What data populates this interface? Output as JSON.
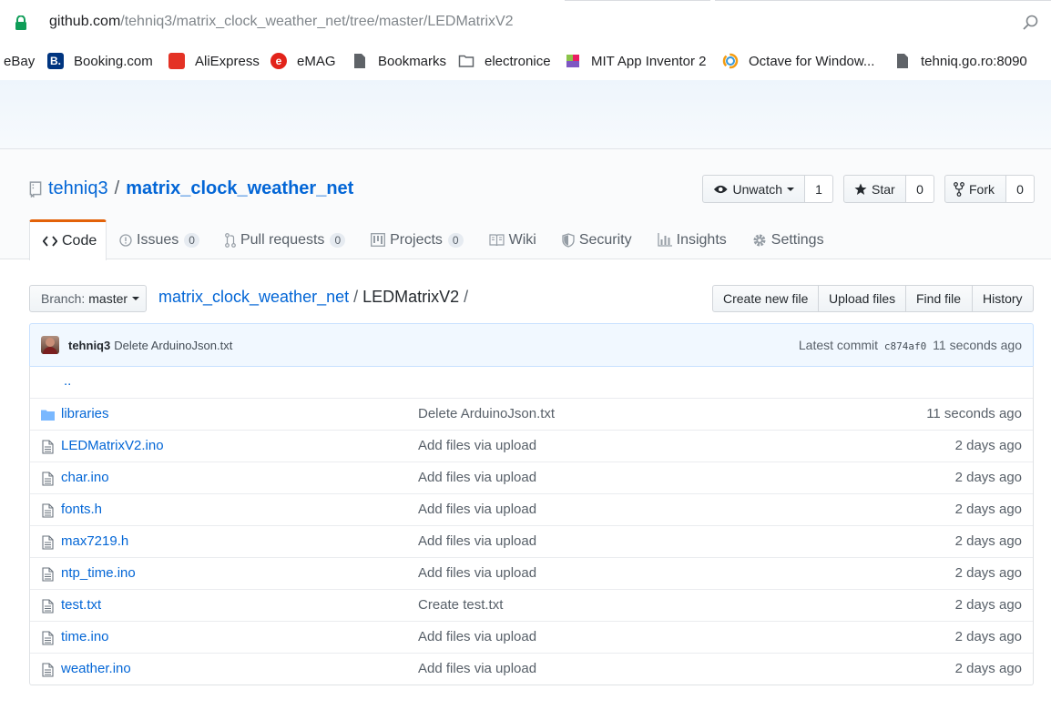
{
  "browser": {
    "url_domain": "github.com",
    "url_path": "/tehniq3/matrix_clock_weather_net/tree/master/LEDMatrixV2"
  },
  "bookmarks": [
    {
      "label": "eBay",
      "icon": "none"
    },
    {
      "label": "Booking.com",
      "icon": "booking-icon"
    },
    {
      "label": "AliExpress",
      "icon": "aliexpress-icon"
    },
    {
      "label": "eMAG",
      "icon": "emag-icon"
    },
    {
      "label": "Bookmarks",
      "icon": "page-icon"
    },
    {
      "label": "electronice",
      "icon": "folder-icon"
    },
    {
      "label": "MIT App Inventor 2",
      "icon": "appinventor-icon"
    },
    {
      "label": "Octave for Window...",
      "icon": "octave-icon"
    },
    {
      "label": "tehniq.go.ro:8090",
      "icon": "page-icon"
    }
  ],
  "repo": {
    "owner": "tehniq3",
    "name": "matrix_clock_weather_net",
    "separator": "/"
  },
  "actions": {
    "watch_label": "Unwatch",
    "watch_count": "1",
    "star_label": "Star",
    "star_count": "0",
    "fork_label": "Fork",
    "fork_count": "0"
  },
  "tabs": [
    {
      "label": "Code",
      "icon": "code-icon",
      "counter": ""
    },
    {
      "label": "Issues",
      "icon": "issue-icon",
      "counter": "0"
    },
    {
      "label": "Pull requests",
      "icon": "pull-request-icon",
      "counter": "0"
    },
    {
      "label": "Projects",
      "icon": "project-icon",
      "counter": "0"
    },
    {
      "label": "Wiki",
      "icon": "book-icon",
      "counter": ""
    },
    {
      "label": "Security",
      "icon": "shield-icon",
      "counter": ""
    },
    {
      "label": "Insights",
      "icon": "graph-icon",
      "counter": ""
    },
    {
      "label": "Settings",
      "icon": "gear-icon",
      "counter": ""
    }
  ],
  "branch": {
    "label": "Branch:",
    "value": "master"
  },
  "breadcrumb": {
    "root": "matrix_clock_weather_net",
    "current": "LEDMatrixV2",
    "sep": "/"
  },
  "file_actions": [
    "Create new file",
    "Upload files",
    "Find file",
    "History"
  ],
  "commit": {
    "author": "tehniq3",
    "message": "Delete ArduinoJson.txt",
    "latest_label": "Latest commit",
    "sha": "c874af0",
    "age": "11 seconds ago"
  },
  "files": {
    "up": "..",
    "rows": [
      {
        "name": "libraries",
        "type": "dir",
        "message": "Delete ArduinoJson.txt",
        "age": "11 seconds ago"
      },
      {
        "name": "LEDMatrixV2.ino",
        "type": "file",
        "message": "Add files via upload",
        "age": "2 days ago"
      },
      {
        "name": "char.ino",
        "type": "file",
        "message": "Add files via upload",
        "age": "2 days ago"
      },
      {
        "name": "fonts.h",
        "type": "file",
        "message": "Add files via upload",
        "age": "2 days ago"
      },
      {
        "name": "max7219.h",
        "type": "file",
        "message": "Add files via upload",
        "age": "2 days ago"
      },
      {
        "name": "ntp_time.ino",
        "type": "file",
        "message": "Add files via upload",
        "age": "2 days ago"
      },
      {
        "name": "test.txt",
        "type": "file",
        "message": "Create test.txt",
        "age": "2 days ago"
      },
      {
        "name": "time.ino",
        "type": "file",
        "message": "Add files via upload",
        "age": "2 days ago"
      },
      {
        "name": "weather.ino",
        "type": "file",
        "message": "Add files via upload",
        "age": "2 days ago"
      }
    ]
  },
  "colors": {
    "link": "#0366d6",
    "accent_tab": "#e36209",
    "text": "#24292e",
    "muted": "#586069"
  }
}
